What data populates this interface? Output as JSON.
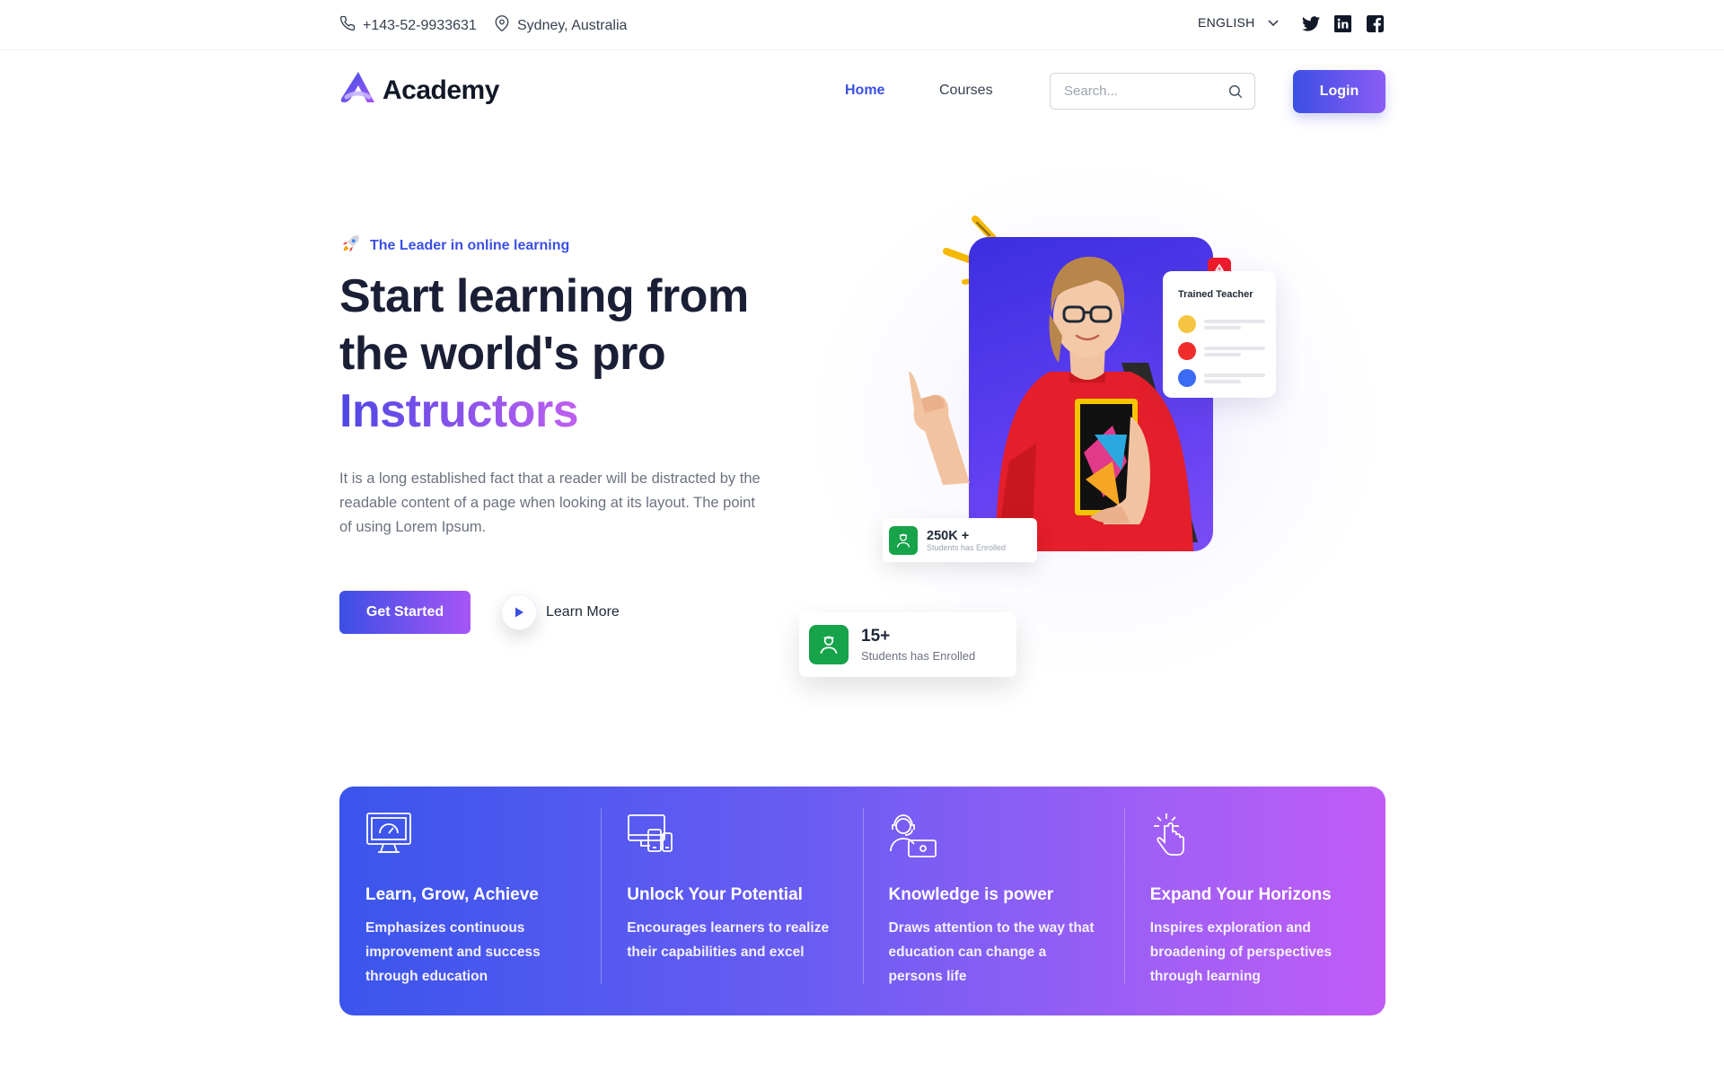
{
  "topbar": {
    "phone": "+143-52-9933631",
    "location": "Sydney, Australia",
    "language": "ENGLISH",
    "social": [
      "twitter-icon",
      "linkedin-icon",
      "facebook-icon"
    ]
  },
  "nav": {
    "brand": "Academy",
    "links": {
      "home": "Home",
      "courses": "Courses"
    },
    "search_placeholder": "Search...",
    "login": "Login"
  },
  "hero": {
    "tagline": "The Leader in online learning",
    "title_line1": "Start learning from",
    "title_line2": "the world's pro",
    "title_highlight": "Instructors",
    "description": "It is a long established fact that a reader will be distracted by the readable content of a page when looking at its layout. The point of using Lorem Ipsum.",
    "cta_primary": "Get Started",
    "cta_secondary": "Learn More",
    "teacher_card_title": "Trained Teacher",
    "teacher_dots": [
      "#f5c542",
      "#ef2b2b",
      "#3b6bf5"
    ],
    "stat_small": {
      "value": "250K +",
      "label": "Students has Enrolled"
    },
    "stat_big": {
      "value": "15+",
      "label": "Students has Enrolled"
    }
  },
  "features": [
    {
      "icon": "monitor-dashboard-icon",
      "title": "Learn, Grow, Achieve",
      "desc": "Emphasizes continuous improvement and success through education"
    },
    {
      "icon": "devices-icon",
      "title": "Unlock Your Potential",
      "desc": "Encourages learners to realize their capabilities and excel"
    },
    {
      "icon": "support-agent-icon",
      "title": "Knowledge is power",
      "desc": "Draws attention to the way that education can change a persons life"
    },
    {
      "icon": "hand-pointer-icon",
      "title": "Expand Your Horizons",
      "desc": "Inspires exploration and broadening of perspectives through learning"
    }
  ],
  "colors": {
    "primary": "#3b4fe4",
    "accent": "#a855f7",
    "success": "#16a34a"
  }
}
